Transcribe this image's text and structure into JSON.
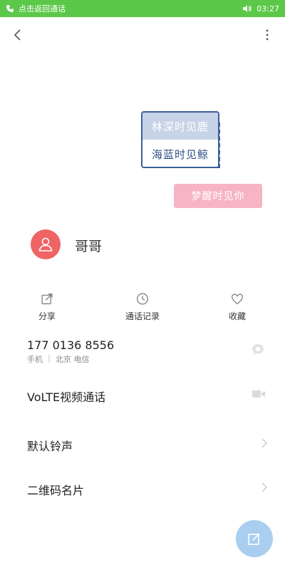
{
  "status_bar": {
    "call_hint": "点击返回通话",
    "time": "03:27"
  },
  "cover": {
    "card_line1": "林深时见鹿",
    "card_line2": "海蓝时见鲸",
    "pink_line": "梦醒时见你"
  },
  "contact": {
    "name": "哥哥"
  },
  "actions": [
    {
      "label": "分享",
      "icon": "share-icon"
    },
    {
      "label": "通话记录",
      "icon": "clock-icon"
    },
    {
      "label": "收藏",
      "icon": "heart-icon"
    }
  ],
  "phone": {
    "number": "177 0136 8556",
    "meta": "手机 ｜ 北京 电信"
  },
  "rows": {
    "volte": "VoLTE视频通话",
    "ringtone": "默认铃声",
    "qr_card": "二维码名片"
  },
  "colors": {
    "status_bar": "#5cc84a",
    "avatar": "#ef6464",
    "card_border": "#3c5f9a",
    "pink_tag": "#f7b4c4",
    "fab": "#a9cef0"
  }
}
